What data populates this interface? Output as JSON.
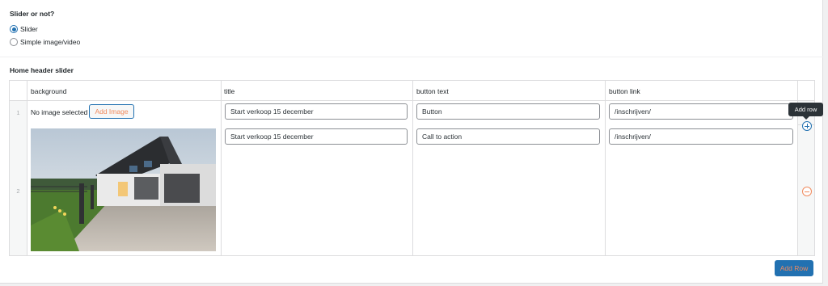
{
  "slider_section": {
    "label": "Slider or not?",
    "options": [
      {
        "label": "Slider",
        "checked": true
      },
      {
        "label": "Simple image/video",
        "checked": false
      }
    ]
  },
  "repeater": {
    "label": "Home header slider",
    "columns": [
      "background",
      "title",
      "button text",
      "button link"
    ],
    "rows": [
      {
        "number": "1",
        "background_text": "No image selected",
        "add_image_label": "Add Image",
        "title": "Start verkoop 15 december",
        "button_text": "Button",
        "button_link": "/inschrijven/"
      },
      {
        "number": "2",
        "background_image": "house-photo",
        "title": "Start verkoop 15 december",
        "button_text": "Call to action",
        "button_link": "/inschrijven/"
      }
    ],
    "tooltip": "Add row",
    "add_row_label": "Add Row"
  },
  "colors": {
    "accent": "#2271b1",
    "orange": "#f08a5d",
    "border": "#dcdcde",
    "tooltip_bg": "#2c3338"
  }
}
